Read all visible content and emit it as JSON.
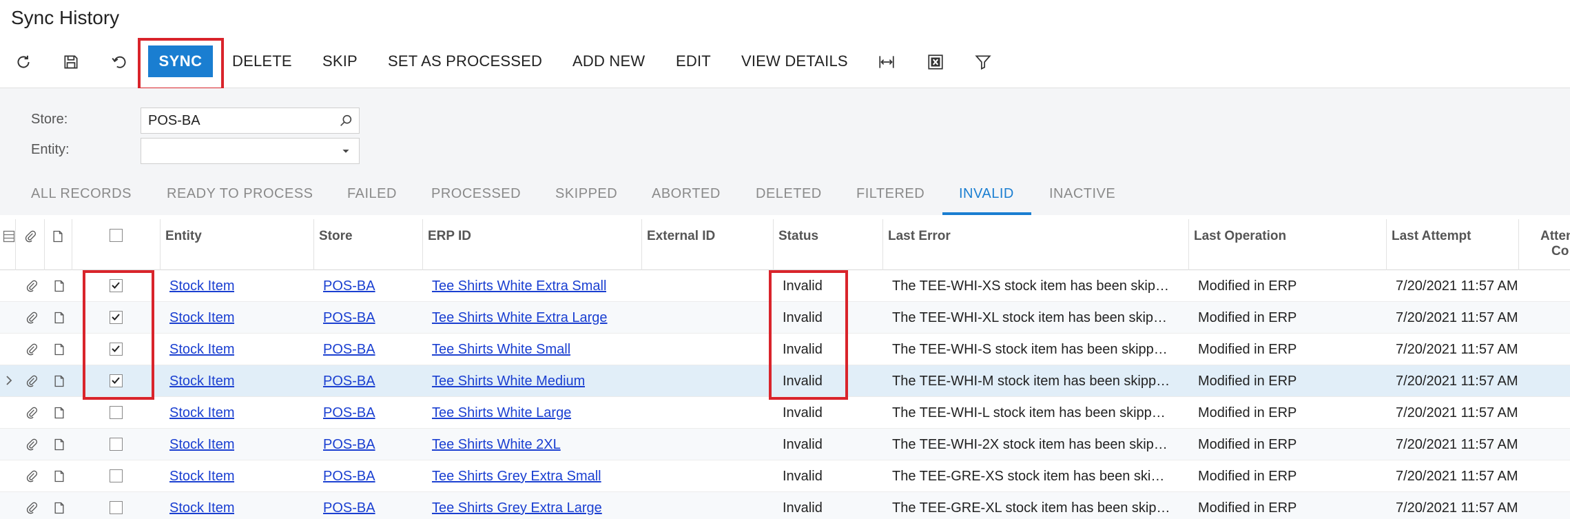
{
  "page": {
    "title": "Sync History"
  },
  "toolbar": {
    "sync_label": "SYNC",
    "delete_label": "DELETE",
    "skip_label": "SKIP",
    "set_processed_label": "SET AS PROCESSED",
    "add_new_label": "ADD NEW",
    "edit_label": "EDIT",
    "view_details_label": "VIEW DETAILS"
  },
  "filters": {
    "store_label": "Store:",
    "store_value": "POS-BA",
    "entity_label": "Entity:",
    "entity_value": ""
  },
  "tabs": [
    {
      "label": "ALL RECORDS"
    },
    {
      "label": "READY TO PROCESS"
    },
    {
      "label": "FAILED"
    },
    {
      "label": "PROCESSED"
    },
    {
      "label": "SKIPPED"
    },
    {
      "label": "ABORTED"
    },
    {
      "label": "DELETED"
    },
    {
      "label": "FILTERED"
    },
    {
      "label": "INVALID"
    },
    {
      "label": "INACTIVE"
    }
  ],
  "active_tab": "INVALID",
  "columns": {
    "entity": "Entity",
    "store": "Store",
    "erp_id": "ERP ID",
    "external_id": "External ID",
    "status": "Status",
    "last_error": "Last Error",
    "last_operation": "Last Operation",
    "last_attempt": "Last Attempt",
    "attempt_count_1": "Atten",
    "attempt_count_2": "Co"
  },
  "rows": [
    {
      "checked": true,
      "entity": "Stock Item",
      "store": "POS-BA",
      "erp_id": "Tee Shirts White Extra Small",
      "external_id": "",
      "status": "Invalid",
      "last_error": "The TEE-WHI-XS stock item has been skip…",
      "last_operation": "Modified in ERP",
      "last_attempt": "7/20/2021 11:57 AM"
    },
    {
      "checked": true,
      "entity": "Stock Item",
      "store": "POS-BA",
      "erp_id": "Tee Shirts White Extra Large",
      "external_id": "",
      "status": "Invalid",
      "last_error": "The TEE-WHI-XL stock item has been skip…",
      "last_operation": "Modified in ERP",
      "last_attempt": "7/20/2021 11:57 AM"
    },
    {
      "checked": true,
      "entity": "Stock Item",
      "store": "POS-BA",
      "erp_id": "Tee Shirts White Small",
      "external_id": "",
      "status": "Invalid",
      "last_error": "The TEE-WHI-S stock item has been skipp…",
      "last_operation": "Modified in ERP",
      "last_attempt": "7/20/2021 11:57 AM"
    },
    {
      "checked": true,
      "entity": "Stock Item",
      "store": "POS-BA",
      "erp_id": "Tee Shirts White Medium",
      "external_id": "",
      "status": "Invalid",
      "last_error": "The TEE-WHI-M stock item has been skipp…",
      "last_operation": "Modified in ERP",
      "last_attempt": "7/20/2021 11:57 AM"
    },
    {
      "checked": false,
      "entity": "Stock Item",
      "store": "POS-BA",
      "erp_id": "Tee Shirts White Large",
      "external_id": "",
      "status": "Invalid",
      "last_error": "The TEE-WHI-L stock item has been skipp…",
      "last_operation": "Modified in ERP",
      "last_attempt": "7/20/2021 11:57 AM"
    },
    {
      "checked": false,
      "entity": "Stock Item",
      "store": "POS-BA",
      "erp_id": "Tee Shirts White 2XL",
      "external_id": "",
      "status": "Invalid",
      "last_error": "The TEE-WHI-2X stock item has been skip…",
      "last_operation": "Modified in ERP",
      "last_attempt": "7/20/2021 11:57 AM"
    },
    {
      "checked": false,
      "entity": "Stock Item",
      "store": "POS-BA",
      "erp_id": "Tee Shirts Grey Extra Small",
      "external_id": "",
      "status": "Invalid",
      "last_error": "The TEE-GRE-XS stock item has been ski…",
      "last_operation": "Modified in ERP",
      "last_attempt": "7/20/2021 11:57 AM"
    },
    {
      "checked": false,
      "entity": "Stock Item",
      "store": "POS-BA",
      "erp_id": "Tee Shirts Grey Extra Large",
      "external_id": "",
      "status": "Invalid",
      "last_error": "The TEE-GRE-XL stock item has been skip…",
      "last_operation": "Modified in ERP",
      "last_attempt": "7/20/2021 11:57 AM"
    }
  ],
  "colors": {
    "accent": "#1a7ed1",
    "highlight": "#d9242b",
    "link": "#1a3fd1"
  },
  "icons": [
    "refresh-icon",
    "save-icon",
    "undo-icon",
    "fit-columns-icon",
    "excel-icon",
    "filter-icon",
    "search-icon",
    "chevron-down-icon",
    "attachment-icon",
    "note-icon"
  ]
}
